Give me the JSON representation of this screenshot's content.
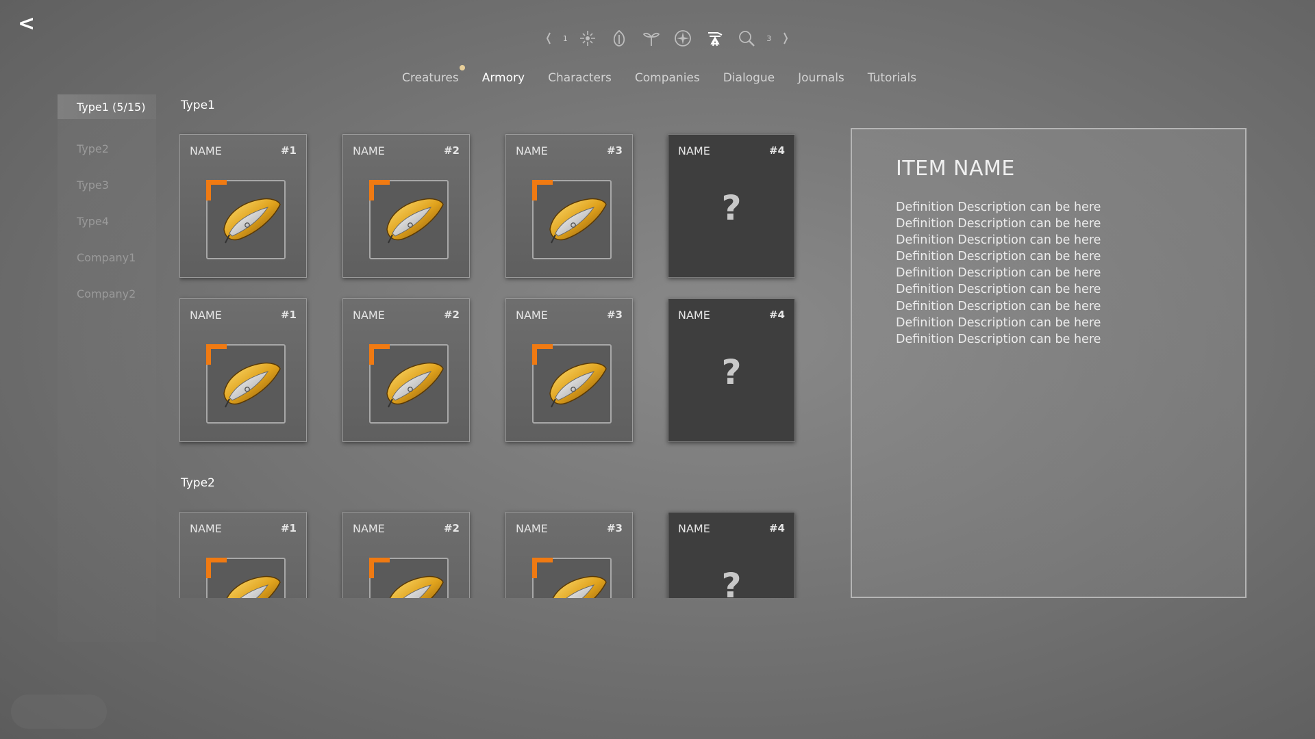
{
  "nav": {
    "back_label": "<",
    "pager_prev": "1",
    "pager_next": "3"
  },
  "tabs": [
    {
      "label": "Creatures",
      "notification": true
    },
    {
      "label": "Armory",
      "active": true
    },
    {
      "label": "Characters"
    },
    {
      "label": "Companies"
    },
    {
      "label": "Dialogue"
    },
    {
      "label": "Journals"
    },
    {
      "label": "Tutorials"
    }
  ],
  "sidebar": {
    "items": [
      {
        "label": "Type1 (5/15)",
        "active": true
      },
      {
        "label": "Type2"
      },
      {
        "label": "Type3"
      },
      {
        "label": "Type4"
      },
      {
        "label": "Company1"
      },
      {
        "label": "Company2"
      }
    ]
  },
  "sections": [
    {
      "title": "Type1",
      "cards": [
        {
          "name": "NAME",
          "num": "#1",
          "locked": false
        },
        {
          "name": "NAME",
          "num": "#2",
          "locked": false
        },
        {
          "name": "NAME",
          "num": "#3",
          "locked": false
        },
        {
          "name": "NAME",
          "num": "#4",
          "locked": true,
          "placeholder": "?"
        },
        {
          "name": "NAME",
          "num": "#1",
          "locked": false
        },
        {
          "name": "NAME",
          "num": "#2",
          "locked": false
        },
        {
          "name": "NAME",
          "num": "#3",
          "locked": false
        },
        {
          "name": "NAME",
          "num": "#4",
          "locked": true,
          "placeholder": "?"
        }
      ]
    },
    {
      "title": "Type2",
      "cards": [
        {
          "name": "NAME",
          "num": "#1",
          "locked": false
        },
        {
          "name": "NAME",
          "num": "#2",
          "locked": false
        },
        {
          "name": "NAME",
          "num": "#3",
          "locked": false
        },
        {
          "name": "NAME",
          "num": "#4",
          "locked": true,
          "placeholder": "?"
        }
      ]
    }
  ],
  "detail": {
    "title": "ITEM NAME",
    "description": [
      "Definition Description can be here",
      "Definition Description can be here",
      "Definition Description can be here",
      "Definition Description can be here",
      "Definition Description can be here",
      "Definition Description can be here",
      "Definition Description can be here",
      "Definition Description can be here",
      "Definition Description can be here"
    ]
  },
  "colors": {
    "accent_orange": "#f07a12",
    "notification_dot": "#e8cf9a",
    "locked_card": "#3e3e3e"
  }
}
